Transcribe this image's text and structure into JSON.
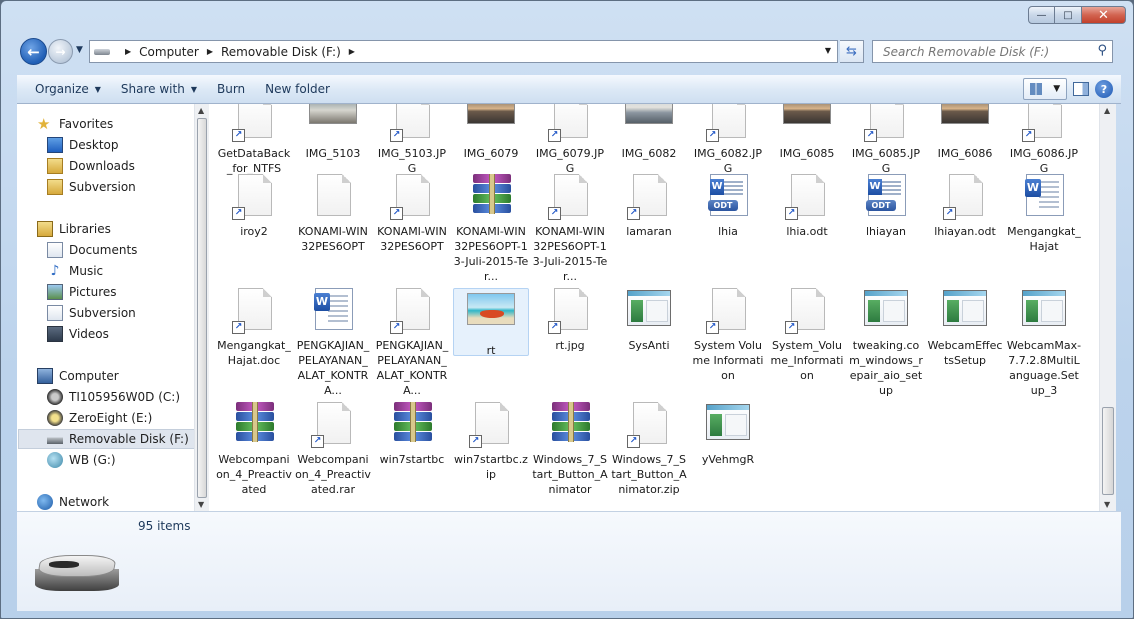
{
  "window": {
    "caption_buttons": {
      "minimize": "—",
      "maximize": "□",
      "close": "✕"
    }
  },
  "address": {
    "crumbs": [
      "Computer",
      "Removable Disk (F:)"
    ],
    "search_placeholder": "Search Removable Disk (F:)"
  },
  "toolbar": {
    "organize": "Organize",
    "share_with": "Share with",
    "burn": "Burn",
    "new_folder": "New folder"
  },
  "nav": {
    "favorites": "Favorites",
    "desktop": "Desktop",
    "downloads": "Downloads",
    "subversion_fav": "Subversion",
    "libraries": "Libraries",
    "documents": "Documents",
    "music": "Music",
    "pictures": "Pictures",
    "subversion_lib": "Subversion",
    "videos": "Videos",
    "computer": "Computer",
    "drive_c": "TI105956W0D (C:)",
    "drive_e": "ZeroEight (E:)",
    "drive_f": "Removable Disk (F:)",
    "drive_g": "WB (G:)",
    "network": "Network"
  },
  "files": [
    {
      "name": "GetDataBack_for_NTFS",
      "icon": "shortcut-doc"
    },
    {
      "name": "IMG_5103",
      "icon": "photo-beach"
    },
    {
      "name": "IMG_5103.JPG",
      "icon": "shortcut-doc"
    },
    {
      "name": "IMG_6079",
      "icon": "photo-sunset"
    },
    {
      "name": "IMG_6079.JPG",
      "icon": "shortcut-doc"
    },
    {
      "name": "IMG_6082",
      "icon": "photo-sea"
    },
    {
      "name": "IMG_6082.JPG",
      "icon": "shortcut-doc"
    },
    {
      "name": "IMG_6085",
      "icon": "photo-sunset"
    },
    {
      "name": "IMG_6085.JPG",
      "icon": "shortcut-doc"
    },
    {
      "name": "IMG_6086",
      "icon": "photo-sunset"
    },
    {
      "name": "IMG_6086.JPG",
      "icon": "shortcut-doc"
    },
    {
      "name": "iroy2",
      "icon": "shortcut-doc"
    },
    {
      "name": "KONAMI-WIN32PES6OPT",
      "icon": "doc"
    },
    {
      "name": "KONAMI-WIN32PES6OPT",
      "icon": "shortcut-doc"
    },
    {
      "name": "KONAMI-WIN32PES6OPT-13-Juli-2015-Ter...",
      "icon": "rar"
    },
    {
      "name": "KONAMI-WIN32PES6OPT-13-Juli-2015-Ter...",
      "icon": "shortcut-doc"
    },
    {
      "name": "lamaran",
      "icon": "shortcut-doc"
    },
    {
      "name": "lhia",
      "icon": "odt"
    },
    {
      "name": "lhia.odt",
      "icon": "shortcut-doc"
    },
    {
      "name": "lhiayan",
      "icon": "odt"
    },
    {
      "name": "lhiayan.odt",
      "icon": "shortcut-doc"
    },
    {
      "name": "Mengangkat_Hajat",
      "icon": "word"
    },
    {
      "name": "Mengangkat_Hajat.doc",
      "icon": "shortcut-doc"
    },
    {
      "name": "PENGKAJIAN_PELAYANAN_ALAT_KONTRA...",
      "icon": "word"
    },
    {
      "name": "PENGKAJIAN_PELAYANAN_ALAT_KONTRA...",
      "icon": "shortcut-doc"
    },
    {
      "name": "rt",
      "icon": "image-rt"
    },
    {
      "name": "rt.jpg",
      "icon": "shortcut-doc"
    },
    {
      "name": "SysAnti",
      "icon": "app"
    },
    {
      "name": "System Volume Information",
      "icon": "shortcut-doc"
    },
    {
      "name": "System_Volume_Information",
      "icon": "shortcut-doc"
    },
    {
      "name": "tweaking.com_windows_repair_aio_setup",
      "icon": "app"
    },
    {
      "name": "WebcamEffectsSetup",
      "icon": "app"
    },
    {
      "name": "WebcamMax-7.7.2.8MultiLanguage.Setup_3",
      "icon": "app"
    },
    {
      "name": "Webcompanion_4_Preactivated",
      "icon": "rar"
    },
    {
      "name": "Webcompanion_4_Preactivated.rar",
      "icon": "shortcut-doc"
    },
    {
      "name": "win7startbc",
      "icon": "rar"
    },
    {
      "name": "win7startbc.zip",
      "icon": "shortcut-doc"
    },
    {
      "name": "Windows_7_Start_Button_Animator",
      "icon": "rar"
    },
    {
      "name": "Windows_7_Start_Button_Animator.zip",
      "icon": "shortcut-doc"
    },
    {
      "name": "yVehmgR",
      "icon": "app"
    }
  ],
  "status": {
    "item_count": "95 items"
  }
}
